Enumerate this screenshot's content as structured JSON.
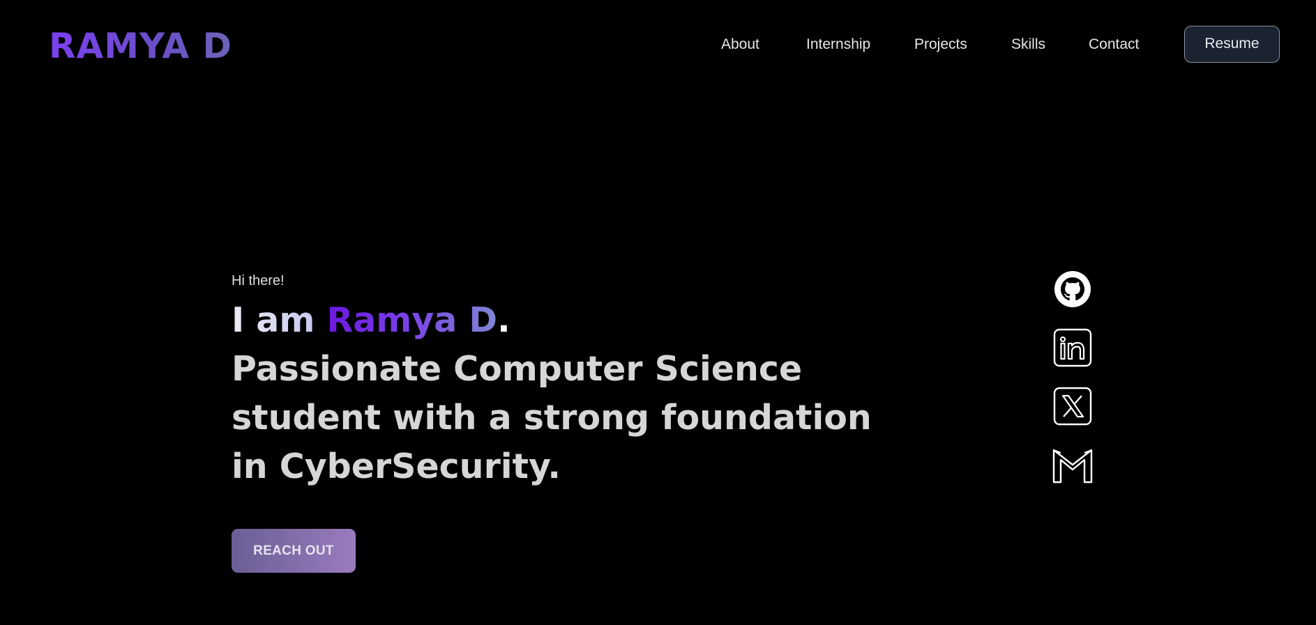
{
  "header": {
    "logo": "RAMYA D",
    "nav": [
      {
        "label": "About"
      },
      {
        "label": "Internship"
      },
      {
        "label": "Projects"
      },
      {
        "label": "Skills"
      },
      {
        "label": "Contact"
      }
    ],
    "resume_label": "Resume"
  },
  "hero": {
    "greeting": "Hi there!",
    "intro_prefix": "I am",
    "name": "Ramya D",
    "name_suffix": ".",
    "tagline_lines": [
      "Passionate Computer Science",
      "student with a strong foundation",
      "in CyberSecurity."
    ],
    "cta_label": "REACH OUT"
  },
  "social": [
    {
      "icon": "github-icon"
    },
    {
      "icon": "linkedin-icon"
    },
    {
      "icon": "x-icon"
    },
    {
      "icon": "gmail-icon"
    }
  ],
  "colors": {
    "background": "#000000",
    "logo_gradient_start": "#7b3ff0",
    "name_gradient_start": "#6a18e0",
    "name_gradient_end": "#7f86d3",
    "headline_text": "#d6d6d6",
    "cta_gradient_start": "#6a5f95",
    "cta_gradient_end": "#9a7bbd",
    "resume_bg": "#1b2230"
  }
}
